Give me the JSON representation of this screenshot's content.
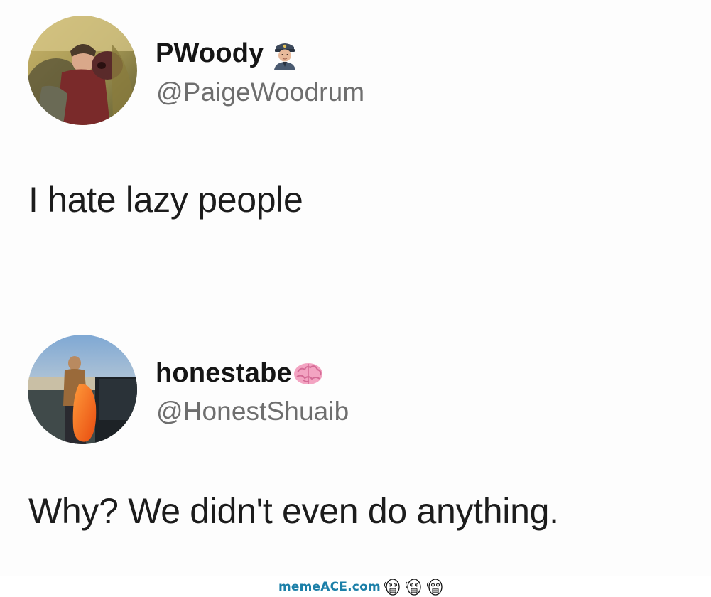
{
  "tweets": [
    {
      "display_name": "PWoody",
      "name_emoji": "police-officer-emoji",
      "handle": "@PaigeWoodrum",
      "text": "I hate lazy people"
    },
    {
      "display_name": "honestabe",
      "name_emoji": "brain-emoji",
      "handle": "@HonestShuaib",
      "text": "Why? We didn't even do anything."
    }
  ],
  "watermark": {
    "text": "memeACE.com",
    "icon": "rage-faces-icon",
    "color": "#1b7fa8"
  },
  "colors": {
    "name": "#151515",
    "handle": "#6e6e6e",
    "body_text": "#1c1c1c"
  }
}
